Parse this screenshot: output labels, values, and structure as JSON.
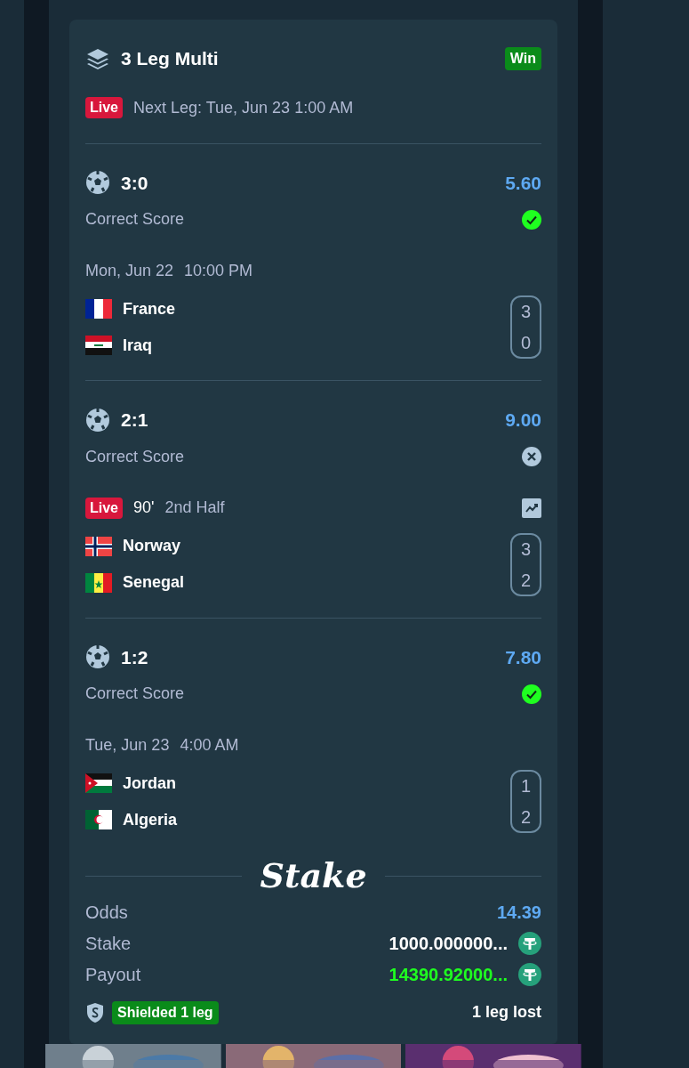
{
  "bet": {
    "title": "3 Leg Multi",
    "result_badge": "Win",
    "status": {
      "badge": "Live",
      "text": "Next Leg: Tue, Jun 23 1:00 AM"
    }
  },
  "legs": [
    {
      "selection": "3:0",
      "odds": "5.60",
      "market": "Correct Score",
      "won": true,
      "status": {
        "kind": "scheduled",
        "parts": [
          "Mon, Jun 22",
          "10:00 PM"
        ]
      },
      "teams": [
        {
          "name": "France",
          "kind": "france",
          "score": "3"
        },
        {
          "name": "Iraq",
          "kind": "iraq",
          "score": "0"
        }
      ]
    },
    {
      "selection": "2:1",
      "odds": "9.00",
      "market": "Correct Score",
      "won": false,
      "status": {
        "kind": "live",
        "badge": "Live",
        "parts": [
          "90'",
          "2nd Half"
        ]
      },
      "teams": [
        {
          "name": "Norway",
          "kind": "norway",
          "score": "3"
        },
        {
          "name": "Senegal",
          "kind": "senegal",
          "score": "2"
        }
      ]
    },
    {
      "selection": "1:2",
      "odds": "7.80",
      "market": "Correct Score",
      "won": true,
      "status": {
        "kind": "scheduled",
        "parts": [
          "Tue, Jun 23",
          "4:00 AM"
        ]
      },
      "teams": [
        {
          "name": "Jordan",
          "kind": "jordan",
          "score": "1"
        },
        {
          "name": "Algeria",
          "kind": "algeria",
          "score": "2"
        }
      ]
    }
  ],
  "logo": "Stake",
  "summary": [
    {
      "label": "Odds",
      "value": "14.39",
      "kind": "odds"
    },
    {
      "label": "Stake",
      "value": "1000.000000...",
      "kind": "amount"
    },
    {
      "label": "Payout",
      "value": "14390.92000...",
      "kind": "payout"
    }
  ],
  "footer": {
    "shield_badge": "Shielded 1 leg",
    "legs_lost": "1 leg lost"
  }
}
